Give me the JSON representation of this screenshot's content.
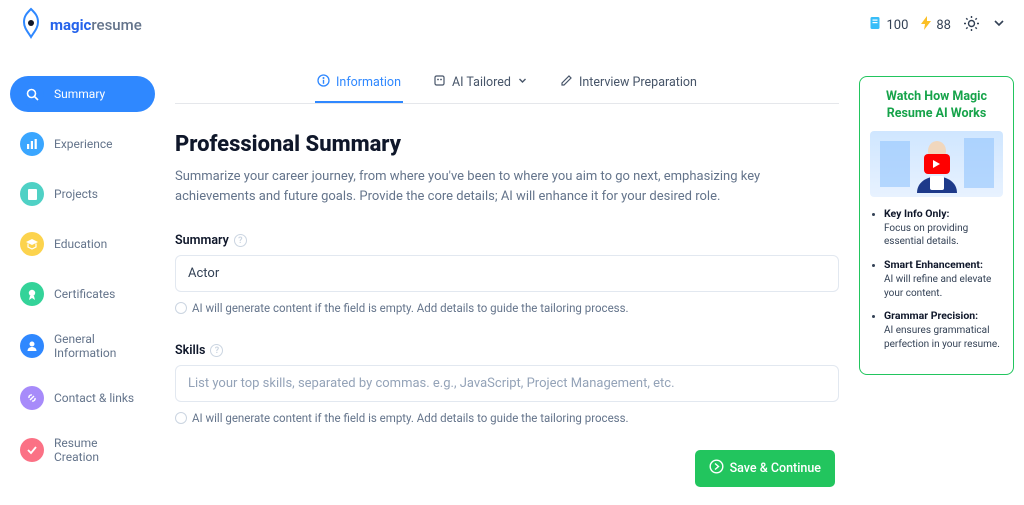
{
  "header": {
    "brand_bold": "magic",
    "brand_light": "resume",
    "credits": "100",
    "energy": "88"
  },
  "sidebar": {
    "items": [
      {
        "label": "Summary",
        "icon_bg": "#2f88ff",
        "active": true
      },
      {
        "label": "Experience",
        "icon_bg": "#3aa6ff",
        "active": false
      },
      {
        "label": "Projects",
        "icon_bg": "#4fd1c5",
        "active": false
      },
      {
        "label": "Education",
        "icon_bg": "#fcd34d",
        "active": false
      },
      {
        "label": "Certificates",
        "icon_bg": "#34d399",
        "active": false
      },
      {
        "label": "General Information",
        "icon_bg": "#2f88ff",
        "active": false
      },
      {
        "label": "Contact & links",
        "icon_bg": "#a78bfa",
        "active": false
      },
      {
        "label": "Resume Creation",
        "icon_bg": "#fb7185",
        "active": false
      }
    ]
  },
  "tabs": {
    "information": "Information",
    "ai_tailored": "AI Tailored",
    "interview_prep": "Interview Preparation"
  },
  "main": {
    "title": "Professional Summary",
    "subtitle": "Summarize your career journey, from where you've been to where you aim to go next, emphasizing key achievements and future goals. Provide the core details; AI will enhance it for your desired role.",
    "summary_label": "Summary",
    "summary_value": "Actor",
    "summary_hint": "AI will generate content if the field is empty. Add details to guide the tailoring process.",
    "skills_label": "Skills",
    "skills_placeholder": "List your top skills, separated by commas. e.g., JavaScript, Project Management, etc.",
    "skills_hint": "AI will generate content if the field is empty. Add details to guide the tailoring process.",
    "save_btn": "Save & Continue"
  },
  "aside": {
    "title": "Watch How Magic Resume AI Works",
    "tips": [
      {
        "title": "Key Info Only:",
        "body": "Focus on providing essential details."
      },
      {
        "title": "Smart Enhancement:",
        "body": "AI will refine and elevate your content."
      },
      {
        "title": "Grammar Precision:",
        "body": "AI ensures grammatical perfection in your resume."
      }
    ]
  }
}
